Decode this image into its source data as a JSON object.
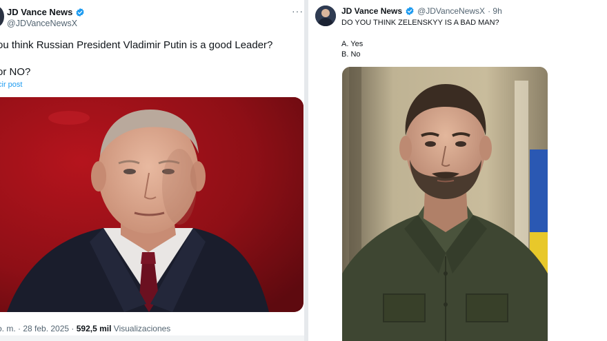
{
  "left_tweet": {
    "author_name": "JD Vance News",
    "author_handle": "@JDVanceNewsX",
    "more_label": "···",
    "text_line1": "ou think Russian President Vladimir Putin is a good Leader?",
    "text_line2": "or NO?",
    "translate_label": "cir post",
    "timestamp": "o. m. · 28 feb. 2025 ·",
    "views_count": "592,5 mil",
    "views_label": "Visualizaciones",
    "image_icon": "putin-portrait",
    "accent_color": "#1d9bf0",
    "image_bg_color": "#8e0f16"
  },
  "right_tweet": {
    "author_name": "JD Vance News",
    "author_handle": "@JDVanceNewsX",
    "time_ago": "· 9h",
    "question": "DO YOU THINK ZELENSKYY IS A BAD MAN?",
    "option_a": "A. Yes",
    "option_b": "B. No",
    "image_icon": "zelensky-portrait",
    "verified_color": "#1d9bf0"
  }
}
